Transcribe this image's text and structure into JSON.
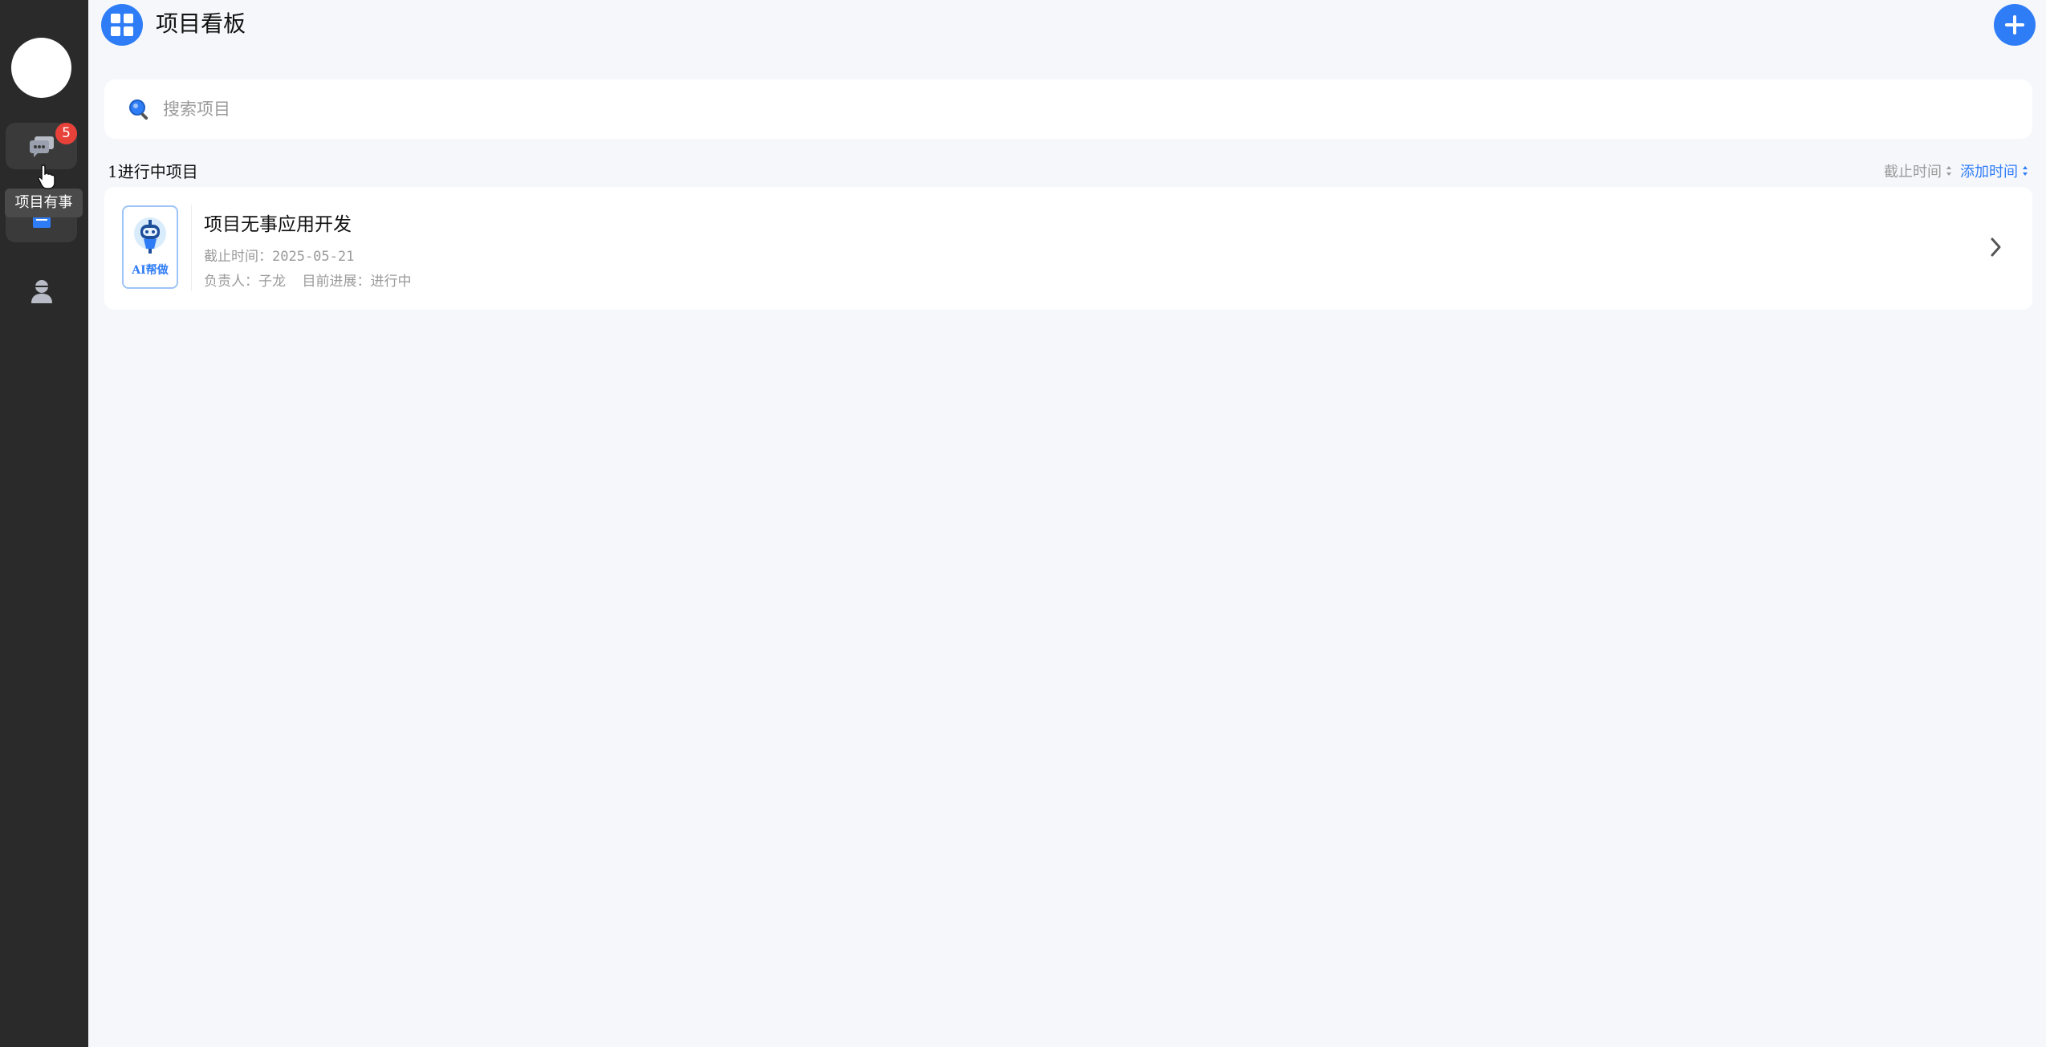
{
  "sidebar": {
    "chat_badge": "5",
    "tooltip": "项目有事"
  },
  "header": {
    "title": "项目看板"
  },
  "search": {
    "placeholder": "搜索项目"
  },
  "list": {
    "section_title": "1进行中项目",
    "sort_deadline": "截止时间",
    "sort_added": "添加时间"
  },
  "project": {
    "thumb_label": "AI帮做",
    "name": "项目无事应用开发",
    "deadline": "截止时间：2025-05-21",
    "meta": "负责人：子龙  目前进展：进行中"
  },
  "colors": {
    "accent": "#2f7df6",
    "sidebar_bg": "#2a2a2a",
    "badge": "#e8413a",
    "page_bg": "#f5f7fb"
  },
  "icons": [
    "grid-icon",
    "plus-icon",
    "chat-icon",
    "board-icon",
    "user-icon",
    "search-icon",
    "chevron-right-icon",
    "robot-icon",
    "hand-cursor-icon"
  ]
}
